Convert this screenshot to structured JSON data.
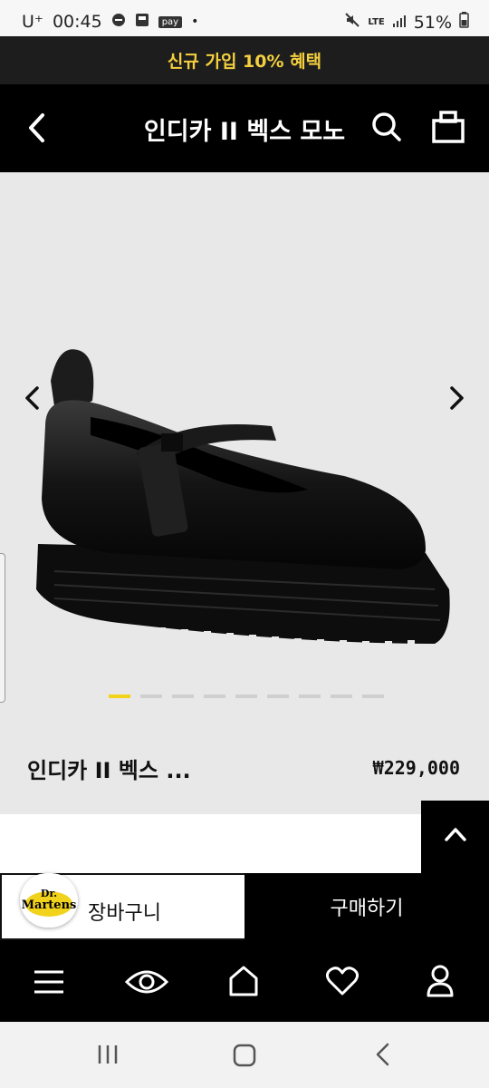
{
  "status_bar": {
    "carrier": "U⁺",
    "time": "00:45",
    "pay_label": "pay",
    "network": "LTE",
    "battery": "51%"
  },
  "promo": {
    "text": "신규 가입 10% 혜택"
  },
  "header": {
    "title": "인디카 II 벡스 모노",
    "icons": [
      "back-icon",
      "search-icon",
      "shopping-bag-icon"
    ]
  },
  "product": {
    "name": "인디카 II 벡스 ...",
    "price": "₩229,000",
    "gallery_count": 9,
    "gallery_active_index": 0
  },
  "actions": {
    "cart_label": "장바구니",
    "buy_label": "구매하기",
    "logo_text": "Dr. Martens"
  },
  "bottom_nav": {
    "icons": [
      "menu-icon",
      "eye-icon",
      "home-icon",
      "heart-icon",
      "user-icon"
    ]
  },
  "colors": {
    "accent": "#f2d31b",
    "promo_bg": "#1d1d1d",
    "header_bg": "#000000",
    "hero_bg": "#e8e8e8"
  }
}
